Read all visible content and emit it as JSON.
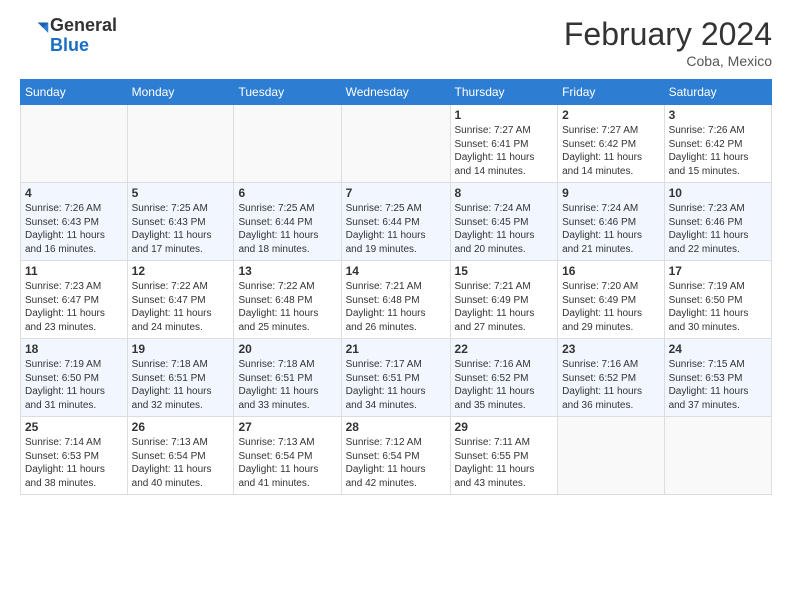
{
  "header": {
    "logo_general": "General",
    "logo_blue": "Blue",
    "month_title": "February 2024",
    "location": "Coba, Mexico"
  },
  "days_of_week": [
    "Sunday",
    "Monday",
    "Tuesday",
    "Wednesday",
    "Thursday",
    "Friday",
    "Saturday"
  ],
  "weeks": [
    {
      "days": [
        {
          "num": "",
          "empty": true
        },
        {
          "num": "",
          "empty": true
        },
        {
          "num": "",
          "empty": true
        },
        {
          "num": "",
          "empty": true
        },
        {
          "num": "1",
          "sunrise": "7:27 AM",
          "sunset": "6:41 PM",
          "daylight": "11 hours and 14 minutes."
        },
        {
          "num": "2",
          "sunrise": "7:27 AM",
          "sunset": "6:42 PM",
          "daylight": "11 hours and 14 minutes."
        },
        {
          "num": "3",
          "sunrise": "7:26 AM",
          "sunset": "6:42 PM",
          "daylight": "11 hours and 15 minutes."
        }
      ]
    },
    {
      "days": [
        {
          "num": "4",
          "sunrise": "7:26 AM",
          "sunset": "6:43 PM",
          "daylight": "11 hours and 16 minutes."
        },
        {
          "num": "5",
          "sunrise": "7:25 AM",
          "sunset": "6:43 PM",
          "daylight": "11 hours and 17 minutes."
        },
        {
          "num": "6",
          "sunrise": "7:25 AM",
          "sunset": "6:44 PM",
          "daylight": "11 hours and 18 minutes."
        },
        {
          "num": "7",
          "sunrise": "7:25 AM",
          "sunset": "6:44 PM",
          "daylight": "11 hours and 19 minutes."
        },
        {
          "num": "8",
          "sunrise": "7:24 AM",
          "sunset": "6:45 PM",
          "daylight": "11 hours and 20 minutes."
        },
        {
          "num": "9",
          "sunrise": "7:24 AM",
          "sunset": "6:46 PM",
          "daylight": "11 hours and 21 minutes."
        },
        {
          "num": "10",
          "sunrise": "7:23 AM",
          "sunset": "6:46 PM",
          "daylight": "11 hours and 22 minutes."
        }
      ]
    },
    {
      "days": [
        {
          "num": "11",
          "sunrise": "7:23 AM",
          "sunset": "6:47 PM",
          "daylight": "11 hours and 23 minutes."
        },
        {
          "num": "12",
          "sunrise": "7:22 AM",
          "sunset": "6:47 PM",
          "daylight": "11 hours and 24 minutes."
        },
        {
          "num": "13",
          "sunrise": "7:22 AM",
          "sunset": "6:48 PM",
          "daylight": "11 hours and 25 minutes."
        },
        {
          "num": "14",
          "sunrise": "7:21 AM",
          "sunset": "6:48 PM",
          "daylight": "11 hours and 26 minutes."
        },
        {
          "num": "15",
          "sunrise": "7:21 AM",
          "sunset": "6:49 PM",
          "daylight": "11 hours and 27 minutes."
        },
        {
          "num": "16",
          "sunrise": "7:20 AM",
          "sunset": "6:49 PM",
          "daylight": "11 hours and 29 minutes."
        },
        {
          "num": "17",
          "sunrise": "7:19 AM",
          "sunset": "6:50 PM",
          "daylight": "11 hours and 30 minutes."
        }
      ]
    },
    {
      "days": [
        {
          "num": "18",
          "sunrise": "7:19 AM",
          "sunset": "6:50 PM",
          "daylight": "11 hours and 31 minutes."
        },
        {
          "num": "19",
          "sunrise": "7:18 AM",
          "sunset": "6:51 PM",
          "daylight": "11 hours and 32 minutes."
        },
        {
          "num": "20",
          "sunrise": "7:18 AM",
          "sunset": "6:51 PM",
          "daylight": "11 hours and 33 minutes."
        },
        {
          "num": "21",
          "sunrise": "7:17 AM",
          "sunset": "6:51 PM",
          "daylight": "11 hours and 34 minutes."
        },
        {
          "num": "22",
          "sunrise": "7:16 AM",
          "sunset": "6:52 PM",
          "daylight": "11 hours and 35 minutes."
        },
        {
          "num": "23",
          "sunrise": "7:16 AM",
          "sunset": "6:52 PM",
          "daylight": "11 hours and 36 minutes."
        },
        {
          "num": "24",
          "sunrise": "7:15 AM",
          "sunset": "6:53 PM",
          "daylight": "11 hours and 37 minutes."
        }
      ]
    },
    {
      "days": [
        {
          "num": "25",
          "sunrise": "7:14 AM",
          "sunset": "6:53 PM",
          "daylight": "11 hours and 38 minutes."
        },
        {
          "num": "26",
          "sunrise": "7:13 AM",
          "sunset": "6:54 PM",
          "daylight": "11 hours and 40 minutes."
        },
        {
          "num": "27",
          "sunrise": "7:13 AM",
          "sunset": "6:54 PM",
          "daylight": "11 hours and 41 minutes."
        },
        {
          "num": "28",
          "sunrise": "7:12 AM",
          "sunset": "6:54 PM",
          "daylight": "11 hours and 42 minutes."
        },
        {
          "num": "29",
          "sunrise": "7:11 AM",
          "sunset": "6:55 PM",
          "daylight": "11 hours and 43 minutes."
        },
        {
          "num": "",
          "empty": true
        },
        {
          "num": "",
          "empty": true
        }
      ]
    }
  ],
  "labels": {
    "sunrise": "Sunrise:",
    "sunset": "Sunset:",
    "daylight": "Daylight:"
  }
}
